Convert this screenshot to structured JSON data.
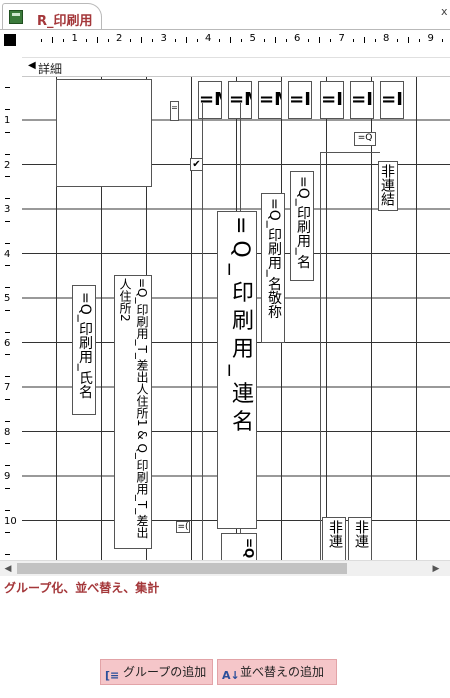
{
  "tab": {
    "title": "R_印刷用",
    "close": "x"
  },
  "ruler": {
    "h_numbers": [
      "1",
      "2",
      "3",
      "4",
      "5",
      "6",
      "7",
      "8",
      "9"
    ],
    "v_numbers": [
      "1",
      "2",
      "3",
      "4",
      "5",
      "6",
      "7",
      "8",
      "9",
      "10"
    ]
  },
  "section": {
    "label": "詳細"
  },
  "controls": {
    "textbox_top_1": "=M",
    "textbox_top_2": "=M",
    "textbox_top_3": "=M",
    "textbox_top_4": "=I",
    "textbox_top_5": "=I",
    "textbox_top_6": "=I",
    "textbox_top_7": "=I",
    "small_q": "=Q",
    "small_left": "=",
    "hiren_label": "非連結",
    "name_field": "=Q_印刷用_名",
    "keisho_field": "=Q_印刷用_名敬称",
    "renmei_field": "=Q_印刷用_連名",
    "sender_address": "=Q_印刷用_T_差出人住所1 & Q_印刷用_T_差出人住所2",
    "shimei_field": "=Q_印刷用_氏名",
    "bottom_small": "=(",
    "bottom_field": "=Q",
    "bottom_hiren_1": "非連",
    "bottom_hiren_2": "非連"
  },
  "group_pane": {
    "title": "グループ化、並べ替え、集計",
    "add_group": "グループの追加",
    "add_sort": "並べ替えの追加"
  }
}
